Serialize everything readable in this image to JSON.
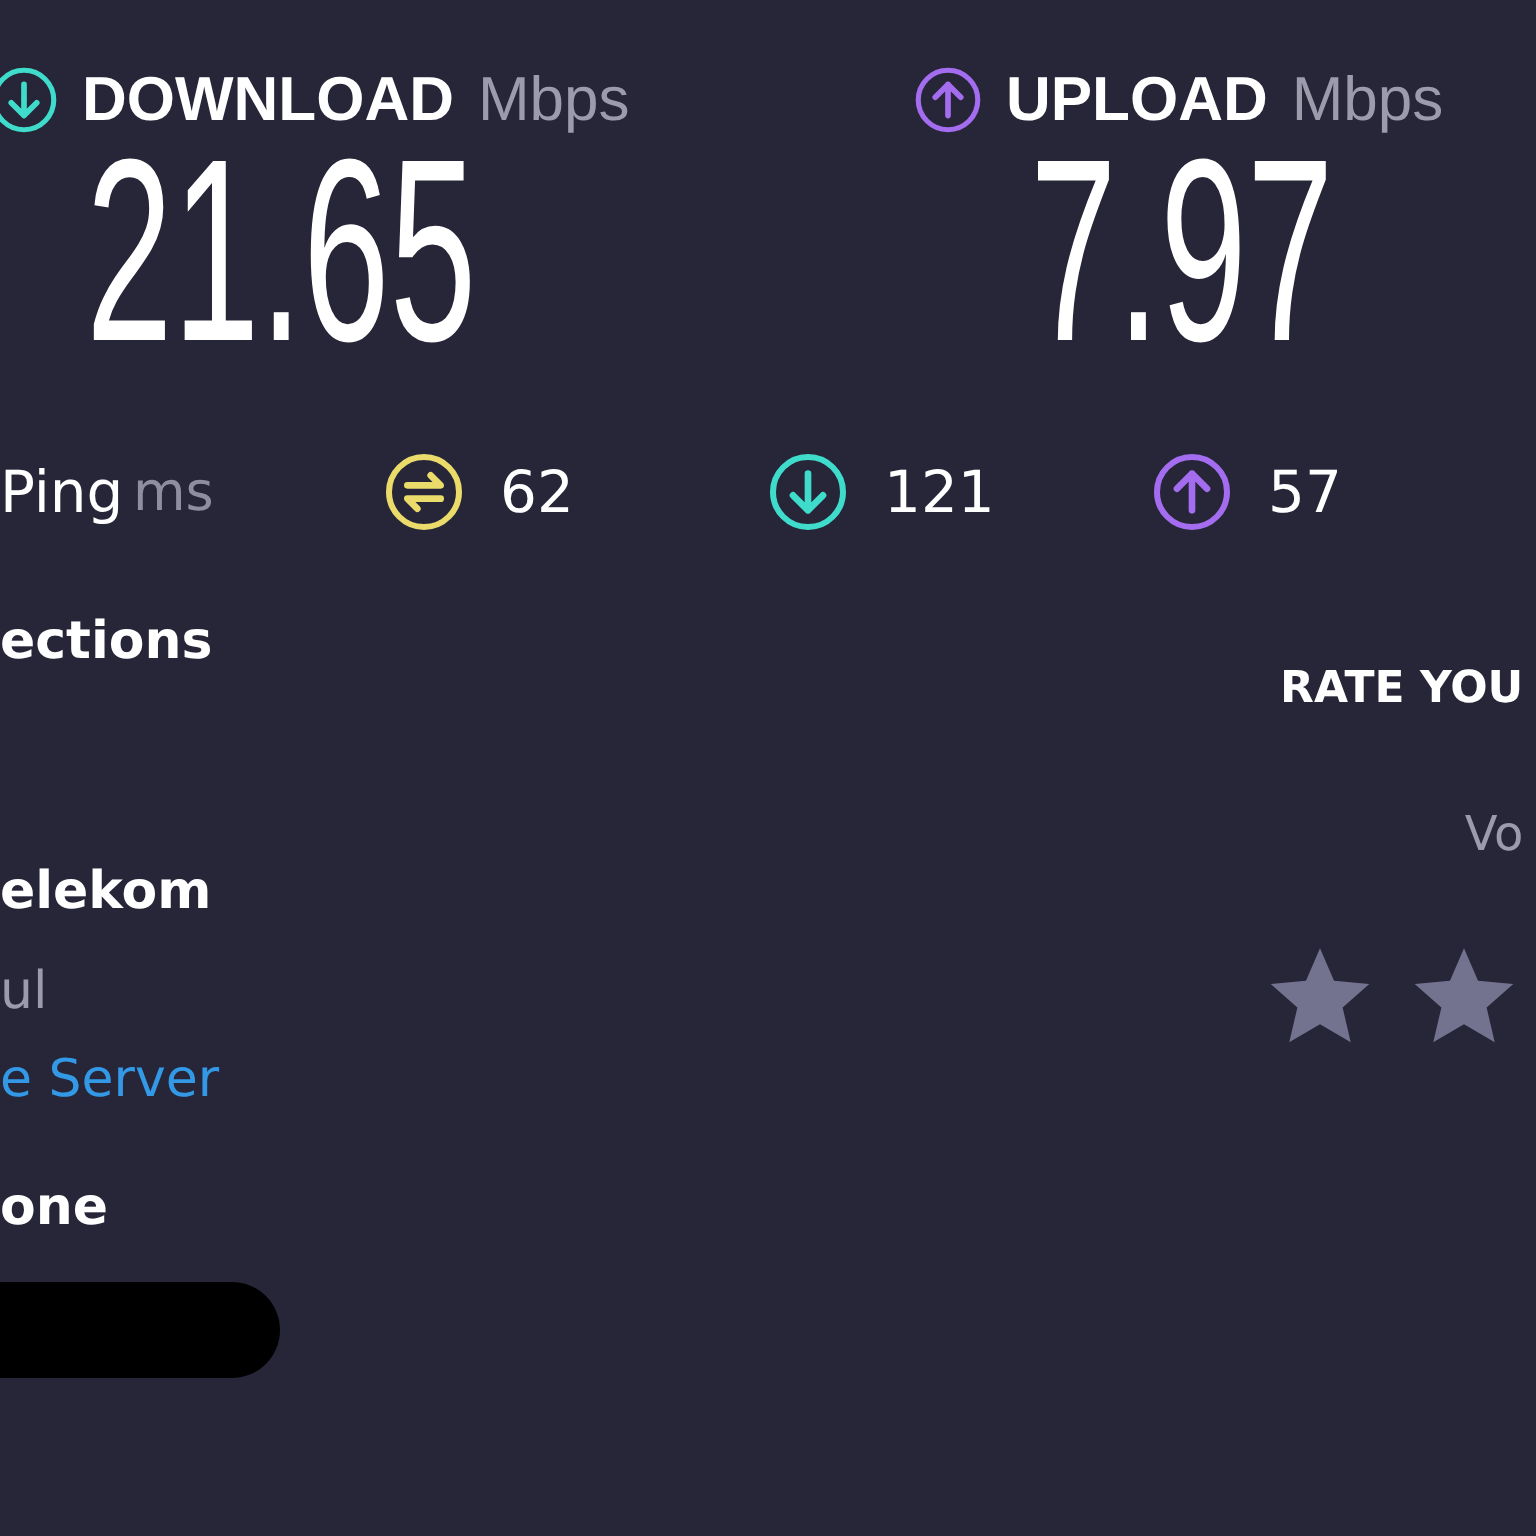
{
  "download": {
    "label": "DOWNLOAD",
    "unit": "Mbps",
    "value": "21.65"
  },
  "upload": {
    "label": "UPLOAD",
    "unit": "Mbps",
    "value": "7.97"
  },
  "ping": {
    "label": "Ping",
    "unit": "ms",
    "items": [
      {
        "kind": "idle",
        "value": "62"
      },
      {
        "kind": "download",
        "value": "121"
      },
      {
        "kind": "upload",
        "value": "57"
      }
    ]
  },
  "connections": {
    "heading": "ections",
    "isp": "elekom",
    "location": "ul",
    "server_link": "e Server",
    "heading_2": "one"
  },
  "rating": {
    "title": "RATE YOU",
    "subtitle": "Vo"
  }
}
